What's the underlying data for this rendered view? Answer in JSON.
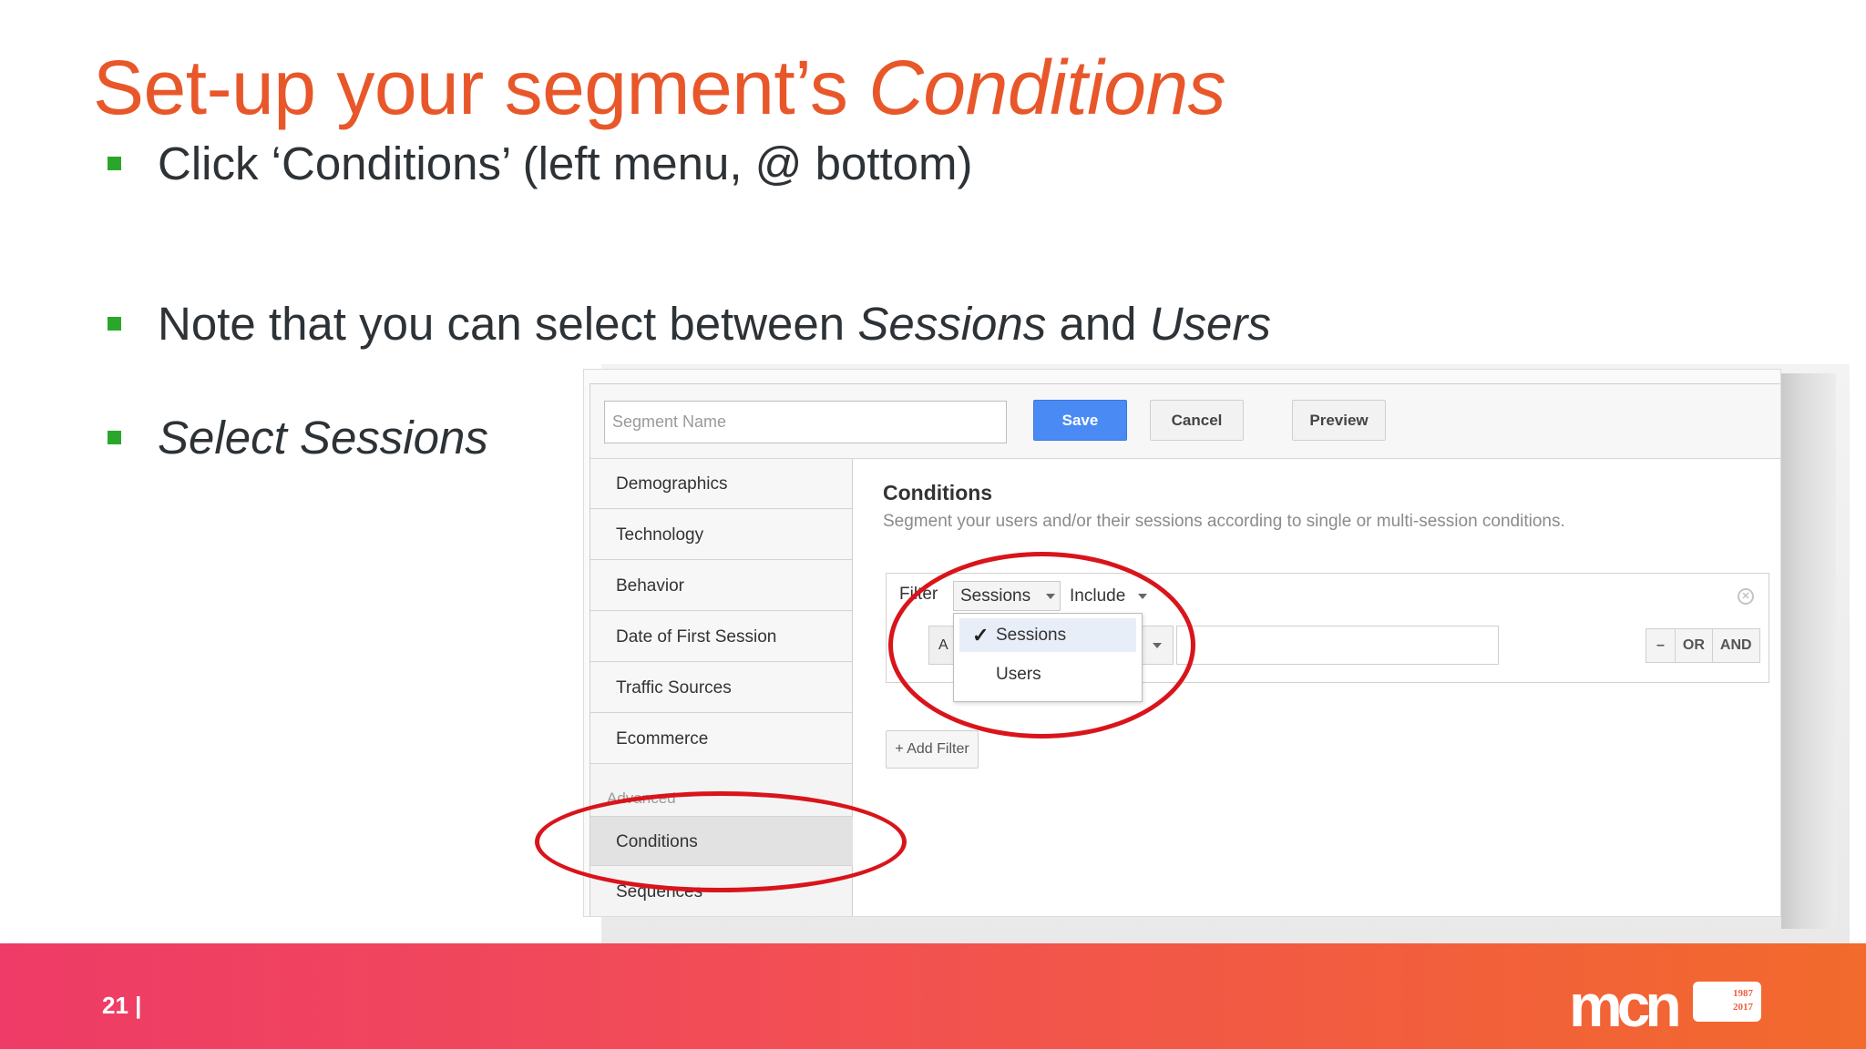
{
  "slide": {
    "title_plain": "Set-up your segment’s",
    "title_italic": "Conditions",
    "bullets": [
      {
        "text": "Click ‘Conditions’ (left menu, @ bottom)"
      },
      {
        "before": "Note that you can select between",
        "italic1": "Sessions",
        "middle": "and",
        "italic2": "Users"
      },
      {
        "plain": "Select",
        "italic": "Sessions"
      }
    ],
    "page_number": "21 |",
    "logo_text": "mcn",
    "logo_tag_lines": [
      "1987",
      "2017"
    ]
  },
  "app": {
    "segment_name_placeholder": "Segment Name",
    "save_label": "Save",
    "cancel_label": "Cancel",
    "preview_label": "Preview",
    "nav": {
      "items": [
        "Demographics",
        "Technology",
        "Behavior",
        "Date of First Session",
        "Traffic Sources",
        "Ecommerce"
      ],
      "advanced_label": "Advanced",
      "conditions_label": "Conditions",
      "sequences_label": "Sequences"
    },
    "conditions": {
      "title": "Conditions",
      "subtitle": "Segment your users and/or their sessions according to single or multi-session conditions.",
      "filter_label": "Filter",
      "scope_value": "Sessions",
      "mode_value": "Include",
      "row_select_value": "A",
      "buttons": [
        "–",
        "OR",
        "AND"
      ],
      "add_filter_label": "+ Add Filter",
      "menu": {
        "options": [
          "Sessions",
          "Users"
        ],
        "selected": "Sessions"
      }
    }
  },
  "colors": {
    "title": "#e8572a",
    "bullet_marker": "#2aa72a",
    "callout": "#d9141b",
    "save_button": "#4a8af4",
    "footer_start": "#ee3b67",
    "footer_end": "#f26a2c"
  },
  "icons": [
    "check-icon",
    "close-icon",
    "caret-down-icon",
    "bullet-marker"
  ]
}
